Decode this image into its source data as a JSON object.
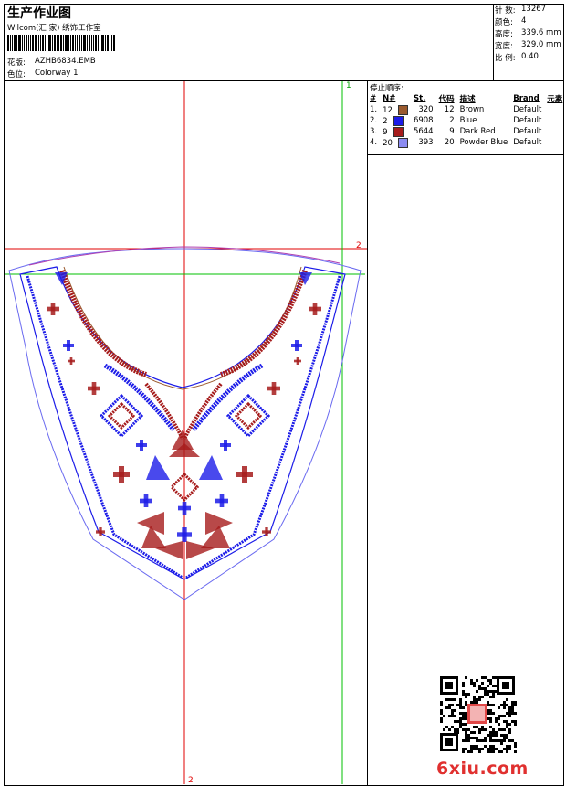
{
  "header": {
    "title": "生产作业图",
    "studio": "Wilcom(汇  家)  绣饰工作室",
    "design_label": "花版:",
    "design_value": "AZHB6834.EMB",
    "colorway_label": "色位:",
    "colorway_value": "Colorway 1"
  },
  "stats": [
    {
      "label": "针  数:",
      "value": "13267"
    },
    {
      "label": "颜色:",
      "value": "4"
    },
    {
      "label": "高度:",
      "value": "339.6 mm"
    },
    {
      "label": "宽度:",
      "value": "329.0 mm"
    },
    {
      "label": "比 例:",
      "value": "0.40"
    }
  ],
  "thread_panel": {
    "title": "停止顺序:",
    "headers": [
      "#",
      "N#",
      "St.",
      "代码",
      "描述",
      "Brand",
      "元素"
    ],
    "rows": [
      {
        "idx": "1.",
        "n": "12",
        "color": "#9a5a2e",
        "st": "320",
        "code": "12",
        "desc": "Brown",
        "brand": "Default"
      },
      {
        "idx": "2.",
        "n": "2",
        "color": "#1c1ce8",
        "st": "6908",
        "code": "2",
        "desc": "Blue",
        "brand": "Default"
      },
      {
        "idx": "3.",
        "n": "9",
        "color": "#a61c1c",
        "st": "5644",
        "code": "9",
        "desc": "Dark Red",
        "brand": "Default"
      },
      {
        "idx": "4.",
        "n": "20",
        "color": "#8c8cf2",
        "st": "393",
        "code": "20",
        "desc": "Powder Blue",
        "brand": "Default"
      }
    ]
  },
  "guides": {
    "green_top": "1",
    "red_right": "2",
    "red_bottom": "2"
  },
  "colors": {
    "red_guide": "#e00000",
    "green_guide": "#00c000",
    "outline": "#6a6af0",
    "magenta": "#b040b0",
    "blue": "#1c1ce8",
    "dark_red": "#a61c1c",
    "brown": "#9a5a2e"
  },
  "watermark": {
    "text": "6xiu.com"
  }
}
